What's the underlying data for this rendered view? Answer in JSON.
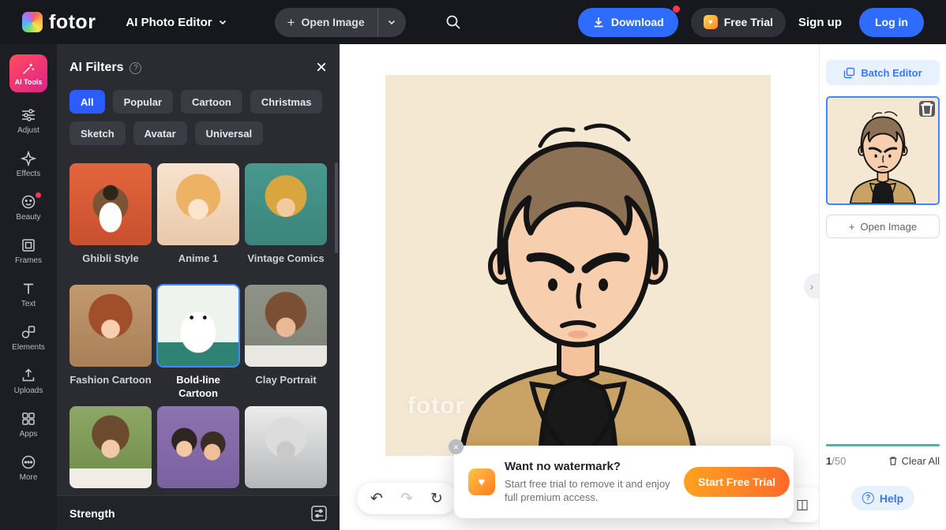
{
  "topbar": {
    "logo": "fotor",
    "app_menu": "AI Photo Editor",
    "open_image": "Open Image",
    "download": "Download",
    "free_trial": "Free Trial",
    "sign_up": "Sign up",
    "log_in": "Log in"
  },
  "sidebar": {
    "items": [
      {
        "label": "AI Tools",
        "icon": "magic-wand-icon",
        "active": true
      },
      {
        "label": "Adjust",
        "icon": "sliders-icon"
      },
      {
        "label": "Effects",
        "icon": "sparkle-icon"
      },
      {
        "label": "Beauty",
        "icon": "face-icon",
        "badge": true
      },
      {
        "label": "Frames",
        "icon": "frame-icon"
      },
      {
        "label": "Text",
        "icon": "text-icon"
      },
      {
        "label": "Elements",
        "icon": "shapes-icon"
      },
      {
        "label": "Uploads",
        "icon": "upload-icon"
      },
      {
        "label": "Apps",
        "icon": "grid-icon"
      },
      {
        "label": "More",
        "icon": "ellipsis-icon"
      }
    ]
  },
  "panel": {
    "title": "AI Filters",
    "tabs": [
      {
        "label": "All",
        "active": true
      },
      {
        "label": "Popular"
      },
      {
        "label": "Cartoon"
      },
      {
        "label": "Christmas"
      },
      {
        "label": "Sketch"
      },
      {
        "label": "Avatar"
      },
      {
        "label": "Universal"
      }
    ],
    "filters": [
      {
        "label": "Ghibli Style"
      },
      {
        "label": "Anime 1"
      },
      {
        "label": "Vintage Comics"
      },
      {
        "label": "Fashion Cartoon"
      },
      {
        "label": "Bold-line Cartoon",
        "selected": true
      },
      {
        "label": "Clay Portrait"
      },
      {
        "label": ""
      },
      {
        "label": ""
      },
      {
        "label": ""
      }
    ],
    "strength_label": "Strength"
  },
  "canvas": {
    "watermark": "fotor",
    "tooltip": {
      "title": "Want no watermark?",
      "body": "Start free trial to remove it and enjoy full premium access.",
      "cta": "Start Free Trial"
    }
  },
  "right_panel": {
    "batch_editor": "Batch Editor",
    "open_image": "Open Image",
    "counter_current": "1",
    "counter_total": "/50",
    "clear_all": "Clear All",
    "help": "Help"
  },
  "colors": {
    "accent_blue": "#2e6bff",
    "panel_dark": "#2b2c31",
    "cta_orange": "#ff7a1a",
    "progress_teal": "#2fc2a1",
    "selected_border": "#3f86ff"
  }
}
